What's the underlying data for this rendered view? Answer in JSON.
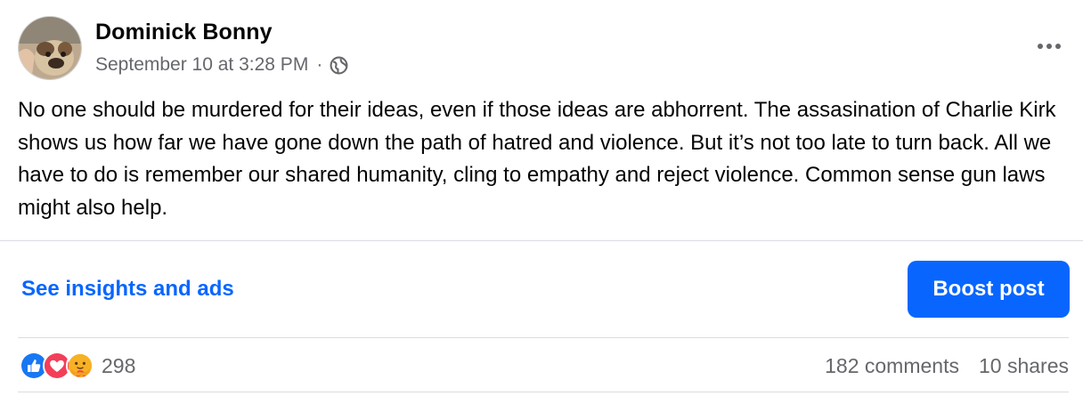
{
  "post": {
    "author": "Dominick Bonny",
    "timestamp": "September 10 at 3:28 PM",
    "separator": "·",
    "privacy_icon": "globe-icon",
    "menu_icon": "more-horizontal-icon",
    "text": "No one should be murdered for their ideas, even if those ideas are abhorrent. The assasination of Charlie Kirk shows us how far we have gone down the path of hatred and violence. But it’s not too late to turn back. All we have to do is remember our shared humanity, cling to empathy and reject violence. Common sense gun laws might also help."
  },
  "actions": {
    "insights_label": "See insights and ads",
    "boost_label": "Boost post"
  },
  "engagement": {
    "reaction_icons": [
      "like-icon",
      "love-icon",
      "care-icon"
    ],
    "reaction_count": "298",
    "comments": "182 comments",
    "shares": "10 shares"
  },
  "colors": {
    "accent": "#0866ff",
    "secondary_text": "#65676b",
    "like": "#1877f2",
    "love": "#f33e58",
    "care": "#f7b125"
  }
}
